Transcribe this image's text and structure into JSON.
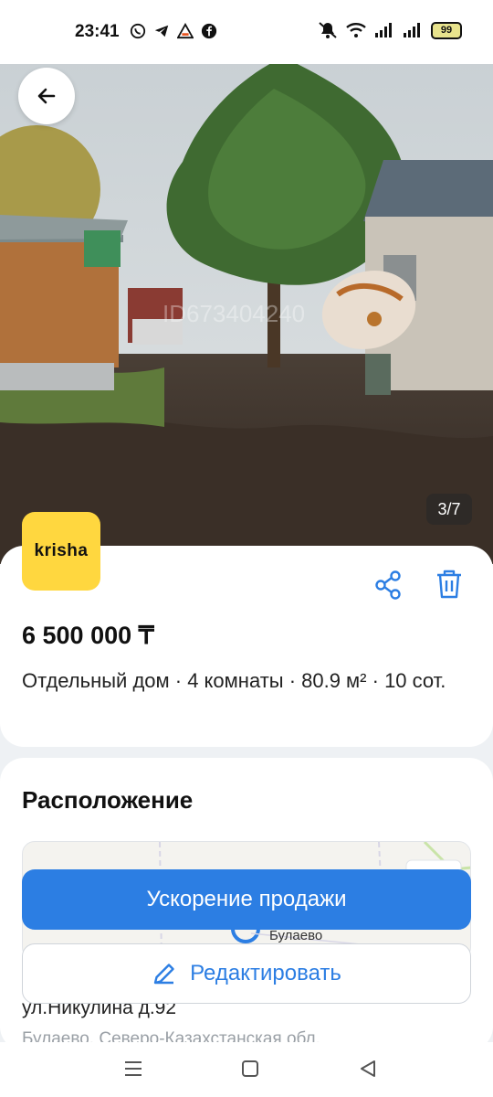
{
  "status_bar": {
    "time": "23:41",
    "battery": "99",
    "app_icons": [
      "whatsapp-icon",
      "telegram-icon",
      "alert-icon",
      "facebook-icon"
    ],
    "system_icons": [
      "mute-icon",
      "wifi-icon",
      "signal-icon",
      "signal-icon"
    ]
  },
  "photo": {
    "counter": "3/7",
    "watermark": "ID673404240"
  },
  "listing": {
    "logo_text": "krisha",
    "price": "6 500 000 ₸",
    "description": "Отдельный дом · 4 комнаты · 80.9 м² · 10 сот."
  },
  "location": {
    "title": "Расположение",
    "map_city": "Булаево",
    "address": "ул.Никулина д.92",
    "address_sub": "Булаево, Северо-Казахстанская обл."
  },
  "actions": {
    "boost_label": "Ускорение продажи",
    "edit_label": "Редактировать"
  },
  "colors": {
    "accent": "#2c7ee3",
    "logo": "#ffd73f"
  }
}
